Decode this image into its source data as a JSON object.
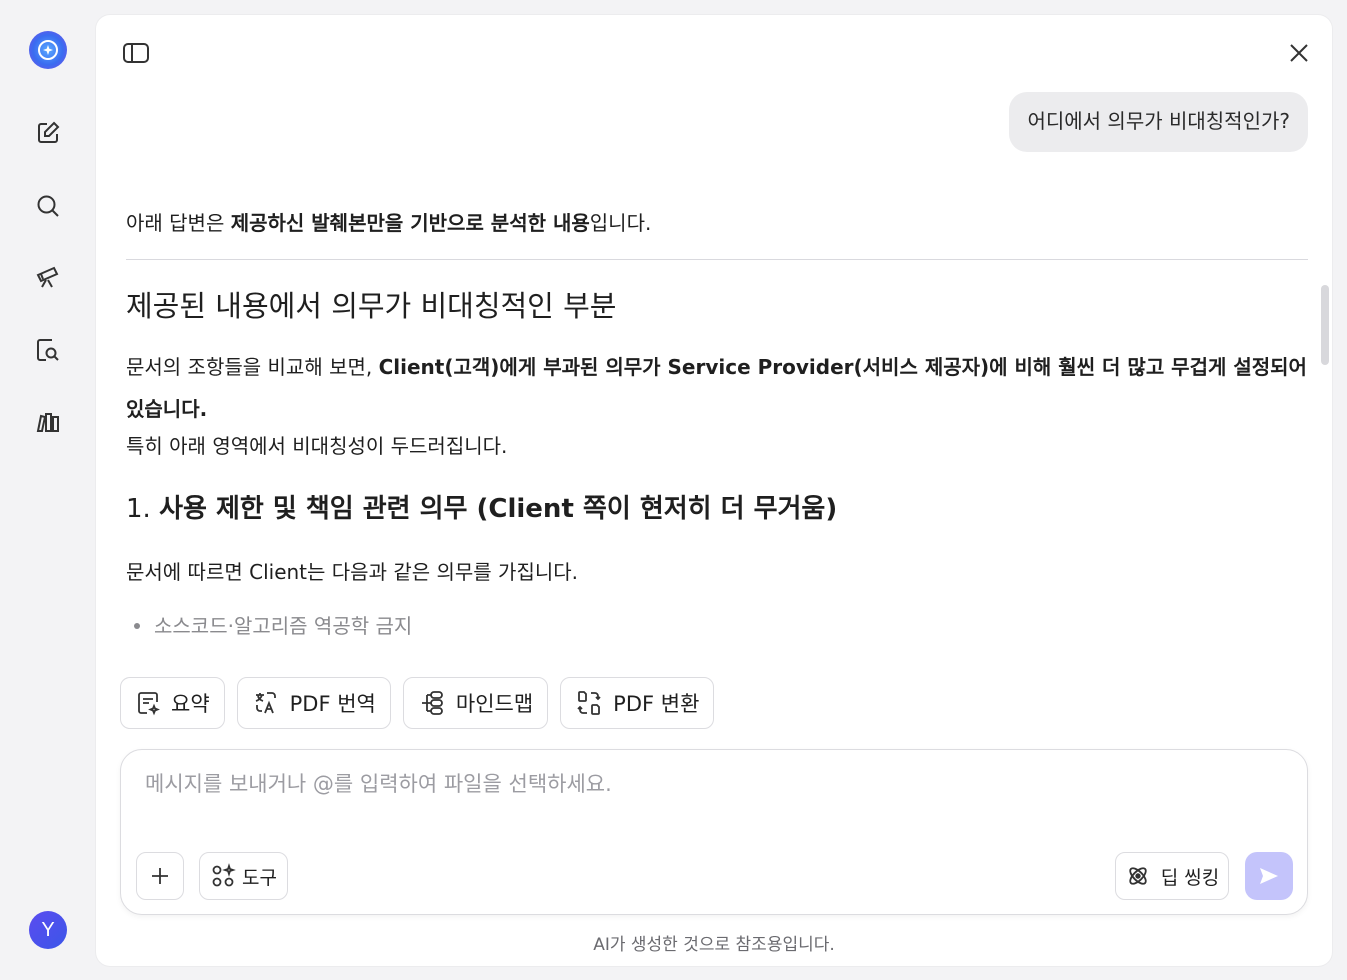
{
  "user_message": "어디에서 의무가 비대칭적인가?",
  "answer": {
    "intro_prefix": "아래 답변은 ",
    "intro_bold": "제공하신 발췌본만을 기반으로 분석한 내용",
    "intro_suffix": "입니다.",
    "heading": "제공된 내용에서 의무가 비대칭적인 부분",
    "para1_prefix": "문서의 조항들을 비교해 보면, ",
    "para1_bold": "Client(고객)에게 부과된 의무가 Service Provider(서비스 제공자)에 비해 훨씬 더 많고 무겁게 설정되어 있습니다.",
    "para2": "특히 아래 영역에서 비대칭성이 두드러집니다.",
    "section1_num": "1. ",
    "section1_bold": "사용 제한 및 책임 관련 의무 (Client 쪽이 현저히 더 무거움)",
    "para3": "문서에 따르면 Client는 다음과 같은 의무를 가집니다.",
    "bullet1": "소스코드·알고리즘 역공학 금지"
  },
  "quick_actions": [
    {
      "label": "요약",
      "icon": "summary-icon"
    },
    {
      "label": "PDF 번역",
      "icon": "translate-icon"
    },
    {
      "label": "마인드맵",
      "icon": "mindmap-icon"
    },
    {
      "label": "PDF 변환",
      "icon": "convert-icon"
    }
  ],
  "composer": {
    "placeholder": "메시지를 보내거나 @를 입력하여 파일을 선택하세요.",
    "tools_label": "도구",
    "deep_thinking_label": "딥 씽킹"
  },
  "disclaimer": "AI가 생성한 것으로 참조용입니다.",
  "user": {
    "avatar_letter": "Y"
  },
  "colors": {
    "accent": "#3a6cf0",
    "send_disabled": "#c4c4fb",
    "bubble": "#ececee"
  }
}
